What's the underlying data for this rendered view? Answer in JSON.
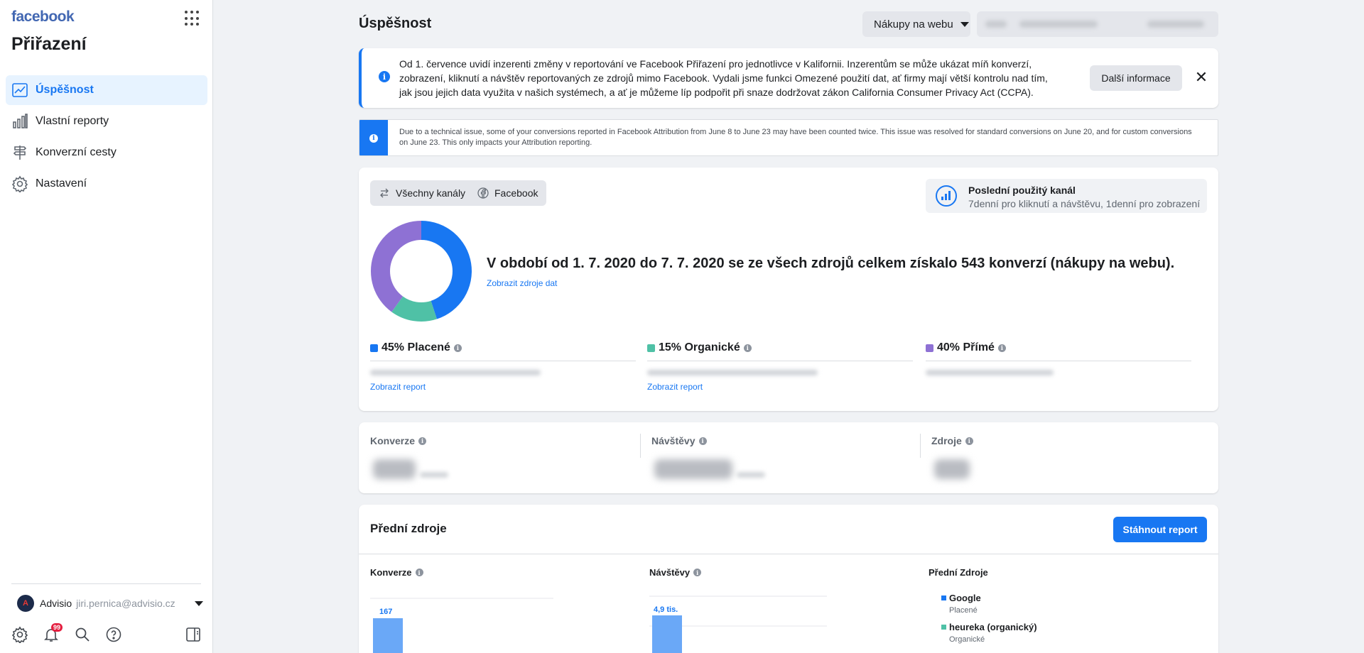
{
  "sidebar": {
    "brand": "facebook",
    "app_title": "Přiřazení",
    "items": [
      {
        "label": "Úspěšnost",
        "icon": "trend-chart-icon",
        "active": true
      },
      {
        "label": "Vlastní reporty",
        "icon": "bar-chart-icon",
        "active": false
      },
      {
        "label": "Konverzní cesty",
        "icon": "signpost-icon",
        "active": false
      },
      {
        "label": "Nastavení",
        "icon": "gear-icon",
        "active": false
      }
    ],
    "account": {
      "avatar_letter": "A",
      "name": "Advisio",
      "email": "jiri.pernica@advisio.cz"
    },
    "notifications_count": "99"
  },
  "header": {
    "title": "Úspěšnost",
    "conversion_select": "Nákupy na webu"
  },
  "notice_ccpa": {
    "text": "Od 1. července uvidí inzerenti změny v reportování ve Facebook Přiřazení pro jednotlivce v Kalifornii. Inzerentům se může ukázat míň konverzí, zobrazení, kliknutí a návštěv reportovaných ze zdrojů mimo Facebook. Vydali jsme funkci Omezené použití dat, ať firmy mají větší kontrolu nad tím, jak jsou jejich data využita v našich systémech, a ať je můžeme líp podpořit při snaze dodržovat zákon California Consumer Privacy Act (CCPA).",
    "button": "Další informace"
  },
  "notice_issue": {
    "text": "Due to a technical issue, some of your conversions reported in Facebook Attribution from June 8 to June 23 may have been counted twice. This issue was resolved for standard conversions on June 20, and for custom conversions on June 23. This only impacts your Attribution reporting."
  },
  "performance": {
    "channel_filter": "Všechny kanály",
    "platform_chip": "Facebook",
    "model_title": "Poslední použitý kanál",
    "model_desc": "7denní pro kliknutí a návštěvu, 1denní pro zobrazení",
    "headline": "V období od 1. 7. 2020 do 7. 7. 2020 se ze všech zdrojů celkem získalo 543 konverzí (nákupy na webu).",
    "data_sources_link": "Zobrazit zdroje dat",
    "view_report": "Zobrazit report",
    "categories": [
      {
        "label": "45% Placené",
        "percent": 45,
        "color": "#1877f2"
      },
      {
        "label": "15% Organické",
        "percent": 15,
        "color": "#4fc1a6"
      },
      {
        "label": "40% Přímé",
        "percent": 40,
        "color": "#8e71d4"
      }
    ]
  },
  "metrics": [
    {
      "label": "Konverze"
    },
    {
      "label": "Návštěvy"
    },
    {
      "label": "Zdroje"
    }
  ],
  "top_sources": {
    "title": "Přední zdroje",
    "download_button": "Stáhnout report",
    "conversions_label": "Konverze",
    "visits_label": "Návštěvy",
    "sources_label": "Přední Zdroje",
    "conversions_top_value": "167",
    "visits_top_value": "4,9 tis.",
    "sources": [
      {
        "name": "Google",
        "type": "Placené",
        "color": "#1877f2"
      },
      {
        "name": "heureka (organický)",
        "type": "Organické",
        "color": "#4fc1a6"
      }
    ]
  }
}
